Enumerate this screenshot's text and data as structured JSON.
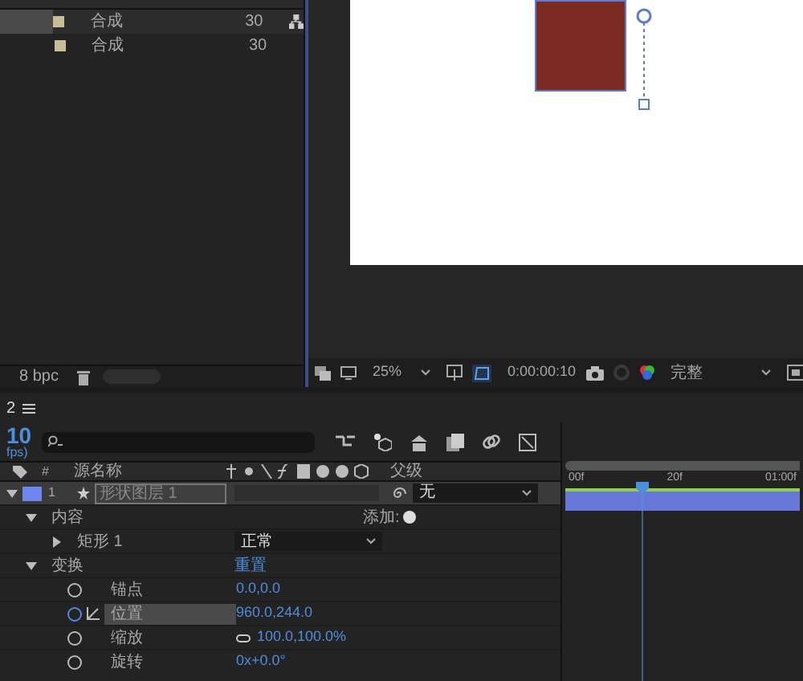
{
  "project_panel": {
    "rows": [
      {
        "name": "合成",
        "frame_rate": "30",
        "selected": true
      },
      {
        "name": "合成",
        "frame_rate": "30",
        "selected": false
      }
    ],
    "bit_depth": "8 bpc"
  },
  "viewer": {
    "zoom": "25%",
    "timecode": "0:00:00:10",
    "resolution": "完整"
  },
  "timeline": {
    "tab": "2",
    "current_time": "10",
    "fps_label": "fps)",
    "columns": [
      "#",
      "源名称",
      "父级"
    ],
    "layer": {
      "number": "1",
      "name": "形状图层 1",
      "parent": "无",
      "selected": true,
      "expanded": true,
      "children": [
        {
          "kind": "group",
          "label": "内容",
          "expanded": true,
          "action": "添加:",
          "children": [
            {
              "kind": "group",
              "label": "矩形 1",
              "expanded": false,
              "blend": "正常"
            }
          ]
        },
        {
          "kind": "group",
          "label": "变换",
          "expanded": true,
          "link": "重置",
          "children": [
            {
              "kind": "property",
              "label": "锚点",
              "value": "0.0,0.0",
              "selected": false,
              "constrain": false
            },
            {
              "kind": "property",
              "label": "位置",
              "value": "960.0,244.0",
              "selected": true,
              "constrain": false
            },
            {
              "kind": "property",
              "label": "缩放",
              "value": "100.0,100.0%",
              "selected": false,
              "constrain": true
            },
            {
              "kind": "property",
              "label": "旋转",
              "value": "0x+0.0°",
              "selected": false,
              "constrain": false
            }
          ]
        }
      ]
    },
    "ruler": [
      "00f",
      "20f",
      "01:00f"
    ]
  }
}
